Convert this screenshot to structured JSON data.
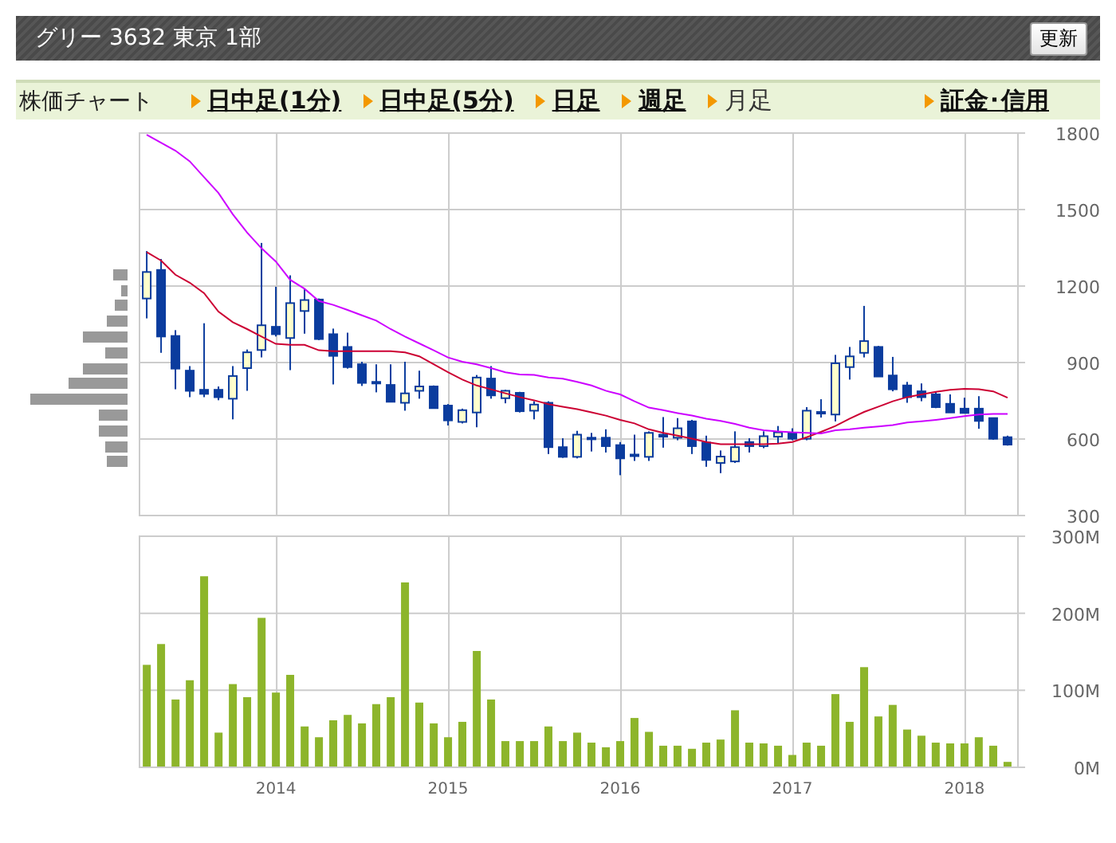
{
  "header": {
    "title": "グリー 3632 東京 1部",
    "button": "更新"
  },
  "section_label": "株価チャート",
  "tabs": [
    {
      "label": "日中足(1分)",
      "selected": false
    },
    {
      "label": "日中足(5分)",
      "selected": false
    },
    {
      "label": "日足",
      "selected": false
    },
    {
      "label": "週足",
      "selected": false
    },
    {
      "label": "月足",
      "selected": true
    },
    {
      "label": "証金･信用",
      "selected": false
    }
  ],
  "price_chart": {
    "chart_data": {
      "type": "candlestick",
      "grid": true,
      "ylim": [
        300,
        1800
      ],
      "yticks": [
        300,
        600,
        900,
        1200,
        1500,
        1800
      ],
      "categories": [
        null,
        null,
        null,
        null,
        null,
        null,
        null,
        null,
        null,
        null,
        null,
        null,
        null,
        null,
        null,
        null,
        null,
        null,
        null,
        null,
        null,
        null,
        null,
        null,
        null,
        null,
        null,
        null,
        null,
        null,
        null,
        null,
        null,
        null,
        null,
        null,
        null,
        null,
        null,
        null,
        null,
        null,
        null,
        null,
        null,
        null,
        null,
        null,
        null,
        null,
        null,
        null,
        null,
        null,
        null,
        null,
        null,
        null,
        null,
        null,
        null
      ],
      "ohlc": [
        [
          1148,
          1334,
          1070,
          1252
        ],
        [
          1260,
          1303,
          935,
          999
        ],
        [
          1001,
          1024,
          792,
          873
        ],
        [
          865,
          883,
          761,
          786
        ],
        [
          790,
          1051,
          761,
          774
        ],
        [
          790,
          803,
          749,
          761
        ],
        [
          755,
          883,
          674,
          844
        ],
        [
          875,
          948,
          786,
          937
        ],
        [
          946,
          1366,
          917,
          1043
        ],
        [
          1037,
          1194,
          999,
          1008
        ],
        [
          993,
          1239,
          867,
          1130
        ],
        [
          1099,
          1186,
          1010,
          1142
        ],
        [
          1144,
          1148,
          985,
          989
        ],
        [
          1008,
          1030,
          811,
          923
        ],
        [
          958,
          1014,
          873,
          879
        ],
        [
          890,
          900,
          805,
          817
        ],
        [
          821,
          890,
          780,
          819
        ],
        [
          809,
          890,
          743,
          743
        ],
        [
          739,
          900,
          708,
          776
        ],
        [
          786,
          865,
          755,
          803
        ],
        [
          803,
          807,
          718,
          718
        ],
        [
          728,
          734,
          650,
          670
        ],
        [
          664,
          716,
          658,
          710
        ],
        [
          701,
          848,
          643,
          838
        ],
        [
          834,
          883,
          755,
          768
        ],
        [
          757,
          790,
          737,
          786
        ],
        [
          778,
          782,
          701,
          706
        ],
        [
          708,
          745,
          674,
          732
        ],
        [
          739,
          745,
          538,
          565
        ],
        [
          565,
          600,
          523,
          527
        ],
        [
          527,
          629,
          521,
          614
        ],
        [
          602,
          621,
          548,
          602
        ],
        [
          602,
          635,
          544,
          569
        ],
        [
          573,
          585,
          455,
          521
        ],
        [
          536,
          614,
          511,
          536
        ],
        [
          527,
          627,
          511,
          621
        ],
        [
          614,
          683,
          563,
          606
        ],
        [
          602,
          679,
          592,
          639
        ],
        [
          666,
          672,
          538,
          569
        ],
        [
          583,
          610,
          488,
          515
        ],
        [
          503,
          552,
          463,
          528
        ],
        [
          509,
          627,
          503,
          565
        ],
        [
          585,
          600,
          544,
          569
        ],
        [
          569,
          627,
          561,
          608
        ],
        [
          606,
          648,
          581,
          623
        ],
        [
          621,
          639,
          592,
          598
        ],
        [
          598,
          722,
          592,
          708
        ],
        [
          703,
          753,
          681,
          703
        ],
        [
          693,
          927,
          666,
          894
        ],
        [
          879,
          958,
          830,
          921
        ],
        [
          935,
          1119,
          917,
          981
        ],
        [
          958,
          962,
          842,
          842
        ],
        [
          846,
          919,
          784,
          792
        ],
        [
          807,
          821,
          739,
          761
        ],
        [
          784,
          815,
          745,
          761
        ],
        [
          772,
          782,
          718,
          722
        ],
        [
          735,
          772,
          701,
          701
        ],
        [
          716,
          759,
          699,
          699
        ],
        [
          716,
          765,
          637,
          668
        ],
        [
          679,
          679,
          594,
          598
        ],
        [
          604,
          610,
          571,
          575
        ]
      ],
      "series": [
        {
          "type": "line",
          "color": "#cc0033",
          "values": [
            1330,
            1297,
            1241,
            1210,
            1169,
            1097,
            1055,
            1028,
            999,
            970,
            966,
            966,
            945,
            941,
            941,
            941,
            941,
            941,
            937,
            921,
            890,
            859,
            830,
            807,
            792,
            776,
            761,
            749,
            734,
            724,
            714,
            701,
            689,
            672,
            658,
            635,
            621,
            610,
            598,
            585,
            577,
            577,
            577,
            577,
            579,
            585,
            604,
            625,
            648,
            677,
            703,
            724,
            745,
            761,
            772,
            782,
            790,
            794,
            792,
            784,
            759
          ]
        },
        {
          "type": "line",
          "color": "#cc00ff",
          "values": [
            1790,
            1759,
            1728,
            1686,
            1624,
            1562,
            1479,
            1407,
            1345,
            1293,
            1221,
            1186,
            1138,
            1123,
            1103,
            1082,
            1061,
            1028,
            999,
            972,
            945,
            917,
            900,
            890,
            875,
            859,
            850,
            848,
            838,
            834,
            821,
            807,
            786,
            772,
            745,
            720,
            710,
            699,
            689,
            677,
            668,
            656,
            641,
            631,
            627,
            623,
            621,
            619,
            631,
            635,
            641,
            646,
            652,
            662,
            666,
            672,
            679,
            687,
            693,
            695,
            695
          ]
        }
      ]
    }
  },
  "volume_chart": {
    "chart_data": {
      "type": "bar",
      "grid": true,
      "ylim": [
        0,
        300
      ],
      "xlim": [
        2013.203,
        2018.306
      ],
      "x": [
        2013.25,
        2013.333,
        2013.417,
        2013.5,
        2013.583,
        2013.667,
        2013.75,
        2013.833,
        2013.917,
        2014,
        2014.083,
        2014.167,
        2014.25,
        2014.333,
        2014.417,
        2014.5,
        2014.583,
        2014.667,
        2014.75,
        2014.833,
        2014.917,
        2015,
        2015.083,
        2015.167,
        2015.25,
        2015.333,
        2015.417,
        2015.5,
        2015.583,
        2015.667,
        2015.75,
        2015.833,
        2015.917,
        2016,
        2016.083,
        2016.167,
        2016.25,
        2016.333,
        2016.417,
        2016.5,
        2016.583,
        2016.667,
        2016.75,
        2016.833,
        2016.917,
        2017,
        2017.083,
        2017.167,
        2017.25,
        2017.333,
        2017.417,
        2017.5,
        2017.583,
        2017.667,
        2017.75,
        2017.833,
        2017.917,
        2018,
        2018.083,
        2018.167,
        2018.25
      ],
      "yticks": [
        {
          "value": 0,
          "label": "0M"
        },
        {
          "value": 100,
          "label": "100M"
        },
        {
          "value": 200,
          "label": "200M"
        },
        {
          "value": 300,
          "label": "300M"
        }
      ],
      "xticks": [
        2014,
        2015,
        2016,
        2017,
        2018
      ],
      "series": [
        {
          "color": "#8db52b",
          "values": [
            132,
            159,
            87,
            112,
            247,
            44,
            107,
            90,
            193,
            96,
            119,
            52,
            38,
            60,
            67,
            56,
            81,
            90,
            239,
            83,
            56,
            38,
            58,
            150,
            87,
            33,
            33,
            33,
            52,
            33,
            44,
            31,
            25,
            33,
            63,
            45,
            27,
            27,
            23,
            31,
            35,
            73,
            31,
            30,
            27,
            15,
            31,
            27,
            94,
            58,
            129,
            65,
            80,
            48,
            40,
            31,
            30,
            30,
            38,
            27,
            6
          ]
        }
      ]
    }
  }
}
